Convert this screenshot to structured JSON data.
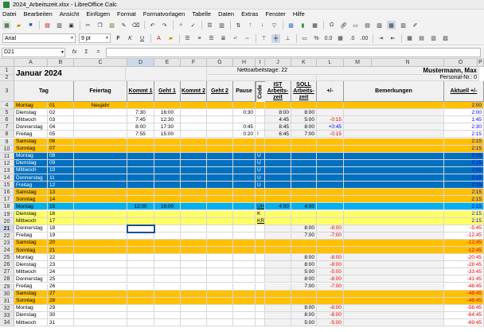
{
  "window": {
    "title": "2024_Arbeitszeit.xlsx - LibreOffice Calc"
  },
  "menu": [
    "Datei",
    "Bearbeiten",
    "Ansicht",
    "Einfügen",
    "Format",
    "Formatvorlagen",
    "Tabelle",
    "Daten",
    "Extras",
    "Fenster",
    "Hilfe"
  ],
  "toolbar2": {
    "font_name": "Arial",
    "font_size": "9 pt",
    "bold": "F",
    "italic": "K",
    "underline": "U"
  },
  "formula": {
    "cell_ref": "D21",
    "fx": "fx",
    "sum": "Σ",
    "eq": "="
  },
  "columns": [
    "A",
    "B",
    "C",
    "D",
    "E",
    "F",
    "G",
    "H",
    "I",
    "J",
    "K",
    "L",
    "M",
    "N",
    "O",
    "P"
  ],
  "header": {
    "month": "Januar 2024",
    "work_days": "Nettoarbeitstage: 22",
    "name": "Mustermann, Max",
    "personnel": "Personal-Nr.: 0",
    "cols": {
      "tag": "Tag",
      "feiertag": "Feiertag",
      "kommt1": "Kommt 1",
      "geht1": "Geht 1",
      "kommt2": "Kommt 2",
      "geht2": "Geht 2",
      "pause": "Pause",
      "code": "Code",
      "ist": "IST Arbeits-zeit",
      "soll": "SOLL Arbeits-zeit",
      "diff": "+/-",
      "bemerkungen": "Bemerkungen",
      "aktuell": "Aktuell +/-"
    }
  },
  "rows": [
    {
      "n": "4",
      "day": "Montag",
      "d": "01",
      "fei": "Neujahr",
      "k1": "",
      "g1": "",
      "k2": "",
      "g2": "",
      "p": "",
      "code": "",
      "ist": "",
      "soll": "",
      "diff": "",
      "akt": "2:00",
      "type": "holiday"
    },
    {
      "n": "5",
      "day": "Dienstag",
      "d": "02",
      "fei": "",
      "k1": "7:30",
      "g1": "16:00",
      "k2": "",
      "g2": "",
      "p": "0:30",
      "code": "",
      "ist": "8:00",
      "soll": "8:00",
      "diff": "",
      "akt": "2:00",
      "type": "normal"
    },
    {
      "n": "6",
      "day": "Mittwoch",
      "d": "03",
      "fei": "",
      "k1": "7:45",
      "g1": "12:30",
      "k2": "",
      "g2": "",
      "p": "",
      "code": "",
      "ist": "4:45",
      "soll": "5:00",
      "diff": "-0:15",
      "akt": "1:45",
      "type": "normal"
    },
    {
      "n": "7",
      "day": "Donnerstag",
      "d": "04",
      "fei": "",
      "k1": "8:00",
      "g1": "17:30",
      "k2": "",
      "g2": "",
      "p": "0:45",
      "code": "",
      "ist": "8:45",
      "soll": "8:00",
      "diff": "+0:45",
      "akt": "2:30",
      "type": "normal"
    },
    {
      "n": "8",
      "day": "Freitag",
      "d": "05",
      "fei": "",
      "k1": "7:55",
      "g1": "15:00",
      "k2": "",
      "g2": "",
      "p": "0:20",
      "code": "!",
      "ist": "6:45",
      "soll": "7:00",
      "diff": "-0:15",
      "akt": "2:15",
      "type": "normal"
    },
    {
      "n": "9",
      "day": "Samstag",
      "d": "06",
      "fei": "",
      "k1": "",
      "g1": "",
      "k2": "",
      "g2": "",
      "p": "",
      "code": "",
      "ist": "",
      "soll": "",
      "diff": "",
      "akt": "2:15",
      "type": "weekend"
    },
    {
      "n": "10",
      "day": "Sonntag",
      "d": "07",
      "fei": "",
      "k1": "",
      "g1": "",
      "k2": "",
      "g2": "",
      "p": "",
      "code": "",
      "ist": "",
      "soll": "",
      "diff": "",
      "akt": "2:15",
      "type": "weekend"
    },
    {
      "n": "11",
      "day": "Montag",
      "d": "08",
      "fei": "",
      "k1": "",
      "g1": "",
      "k2": "",
      "g2": "",
      "p": "",
      "code": "U",
      "ist": "",
      "soll": "",
      "diff": "",
      "akt": "2:15",
      "type": "vacation"
    },
    {
      "n": "12",
      "day": "Dienstag",
      "d": "09",
      "fei": "",
      "k1": "",
      "g1": "",
      "k2": "",
      "g2": "",
      "p": "",
      "code": "U",
      "ist": "",
      "soll": "",
      "diff": "",
      "akt": "2:15",
      "type": "vacation"
    },
    {
      "n": "13",
      "day": "Mittwoch",
      "d": "10",
      "fei": "",
      "k1": "",
      "g1": "",
      "k2": "",
      "g2": "",
      "p": "",
      "code": "U",
      "ist": "",
      "soll": "",
      "diff": "",
      "akt": "2:15",
      "type": "vacation"
    },
    {
      "n": "14",
      "day": "Donnerstag",
      "d": "11",
      "fei": "",
      "k1": "",
      "g1": "",
      "k2": "",
      "g2": "",
      "p": "",
      "code": "U",
      "ist": "",
      "soll": "",
      "diff": "",
      "akt": "2:15",
      "type": "vacation"
    },
    {
      "n": "15",
      "day": "Freitag",
      "d": "12",
      "fei": "",
      "k1": "",
      "g1": "",
      "k2": "",
      "g2": "",
      "p": "",
      "code": "U",
      "ist": "",
      "soll": "",
      "diff": "",
      "akt": "2:15",
      "type": "vacation"
    },
    {
      "n": "16",
      "day": "Samstag",
      "d": "13",
      "fei": "",
      "k1": "",
      "g1": "",
      "k2": "",
      "g2": "",
      "p": "",
      "code": "",
      "ist": "",
      "soll": "",
      "diff": "",
      "akt": "2:15",
      "type": "weekend"
    },
    {
      "n": "17",
      "day": "Sonntag",
      "d": "14",
      "fei": "",
      "k1": "",
      "g1": "",
      "k2": "",
      "g2": "",
      "p": "",
      "code": "",
      "ist": "",
      "soll": "",
      "diff": "",
      "akt": "2:15",
      "type": "weekend"
    },
    {
      "n": "18",
      "day": "Montag",
      "d": "15",
      "fei": "",
      "k1": "12:00",
      "g1": "16:00",
      "k2": "",
      "g2": "",
      "p": "",
      "code": "UH",
      "ist": "4:00",
      "soll": "4:00",
      "diff": "",
      "akt": "2:15",
      "type": "halfday"
    },
    {
      "n": "19",
      "day": "Dienstag",
      "d": "16",
      "fei": "",
      "k1": "",
      "g1": "",
      "k2": "",
      "g2": "",
      "p": "",
      "code": "K",
      "ist": "",
      "soll": "",
      "diff": "",
      "akt": "2:15",
      "type": "sick"
    },
    {
      "n": "20",
      "day": "Mittwoch",
      "d": "17",
      "fei": "",
      "k1": "",
      "g1": "",
      "k2": "",
      "g2": "",
      "p": "",
      "code": "KR",
      "ist": "",
      "soll": "",
      "diff": "",
      "akt": "2:15",
      "type": "sick"
    },
    {
      "n": "21",
      "day": "Donnerstag",
      "d": "18",
      "fei": "",
      "k1": "",
      "g1": "",
      "k2": "",
      "g2": "",
      "p": "",
      "code": "",
      "ist": "",
      "soll": "8:00",
      "diff": "-8:00",
      "akt": "-5:45",
      "type": "normal"
    },
    {
      "n": "22",
      "day": "Freitag",
      "d": "19",
      "fei": "",
      "k1": "",
      "g1": "",
      "k2": "",
      "g2": "",
      "p": "",
      "code": "",
      "ist": "",
      "soll": "7:00",
      "diff": "-7:00",
      "akt": "-12:45",
      "type": "normal"
    },
    {
      "n": "23",
      "day": "Samstag",
      "d": "20",
      "fei": "",
      "k1": "",
      "g1": "",
      "k2": "",
      "g2": "",
      "p": "",
      "code": "",
      "ist": "",
      "soll": "",
      "diff": "",
      "akt": "-12:45",
      "type": "weekend"
    },
    {
      "n": "24",
      "day": "Sonntag",
      "d": "21",
      "fei": "",
      "k1": "",
      "g1": "",
      "k2": "",
      "g2": "",
      "p": "",
      "code": "",
      "ist": "",
      "soll": "",
      "diff": "",
      "akt": "-12:45",
      "type": "weekend"
    },
    {
      "n": "25",
      "day": "Montag",
      "d": "22",
      "fei": "",
      "k1": "",
      "g1": "",
      "k2": "",
      "g2": "",
      "p": "",
      "code": "",
      "ist": "",
      "soll": "8:00",
      "diff": "-8:00",
      "akt": "-20:45",
      "type": "normal"
    },
    {
      "n": "26",
      "day": "Dienstag",
      "d": "23",
      "fei": "",
      "k1": "",
      "g1": "",
      "k2": "",
      "g2": "",
      "p": "",
      "code": "",
      "ist": "",
      "soll": "8:00",
      "diff": "-8:00",
      "akt": "-28:45",
      "type": "normal"
    },
    {
      "n": "27",
      "day": "Mittwoch",
      "d": "24",
      "fei": "",
      "k1": "",
      "g1": "",
      "k2": "",
      "g2": "",
      "p": "",
      "code": "",
      "ist": "",
      "soll": "5:00",
      "diff": "-5:00",
      "akt": "-33:45",
      "type": "normal"
    },
    {
      "n": "28",
      "day": "Donnerstag",
      "d": "25",
      "fei": "",
      "k1": "",
      "g1": "",
      "k2": "",
      "g2": "",
      "p": "",
      "code": "",
      "ist": "",
      "soll": "8:00",
      "diff": "-8:00",
      "akt": "-41:45",
      "type": "normal"
    },
    {
      "n": "29",
      "day": "Freitag",
      "d": "26",
      "fei": "",
      "k1": "",
      "g1": "",
      "k2": "",
      "g2": "",
      "p": "",
      "code": "",
      "ist": "",
      "soll": "7:00",
      "diff": "-7:00",
      "akt": "-48:45",
      "type": "normal"
    },
    {
      "n": "30",
      "day": "Samstag",
      "d": "27",
      "fei": "",
      "k1": "",
      "g1": "",
      "k2": "",
      "g2": "",
      "p": "",
      "code": "",
      "ist": "",
      "soll": "",
      "diff": "",
      "akt": "-48:45",
      "type": "weekend"
    },
    {
      "n": "31",
      "day": "Sonntag",
      "d": "28",
      "fei": "",
      "k1": "",
      "g1": "",
      "k2": "",
      "g2": "",
      "p": "",
      "code": "",
      "ist": "",
      "soll": "",
      "diff": "",
      "akt": "-48:45",
      "type": "weekend"
    },
    {
      "n": "32",
      "day": "Montag",
      "d": "29",
      "fei": "",
      "k1": "",
      "g1": "",
      "k2": "",
      "g2": "",
      "p": "",
      "code": "",
      "ist": "",
      "soll": "8:00",
      "diff": "-8:00",
      "akt": "-56:45",
      "type": "normal"
    },
    {
      "n": "33",
      "day": "Dienstag",
      "d": "30",
      "fei": "",
      "k1": "",
      "g1": "",
      "k2": "",
      "g2": "",
      "p": "",
      "code": "",
      "ist": "",
      "soll": "8:00",
      "diff": "-8:00",
      "akt": "-64:45",
      "type": "normal"
    },
    {
      "n": "34",
      "day": "Mittwoch",
      "d": "31",
      "fei": "",
      "k1": "",
      "g1": "",
      "k2": "",
      "g2": "",
      "p": "",
      "code": "",
      "ist": "",
      "soll": "5:00",
      "diff": "-5:00",
      "akt": "-69:45",
      "type": "normal"
    }
  ],
  "colors": {
    "holiday": "#ffc000",
    "weekend": "#ffc000",
    "vacation": "#0070c0",
    "halfday": "#00b0f0",
    "sick": "#ffff66",
    "normal": "#ffffff",
    "negative": "#e00000",
    "positive": "#0000ee",
    "selection": "#cdd9ea"
  }
}
